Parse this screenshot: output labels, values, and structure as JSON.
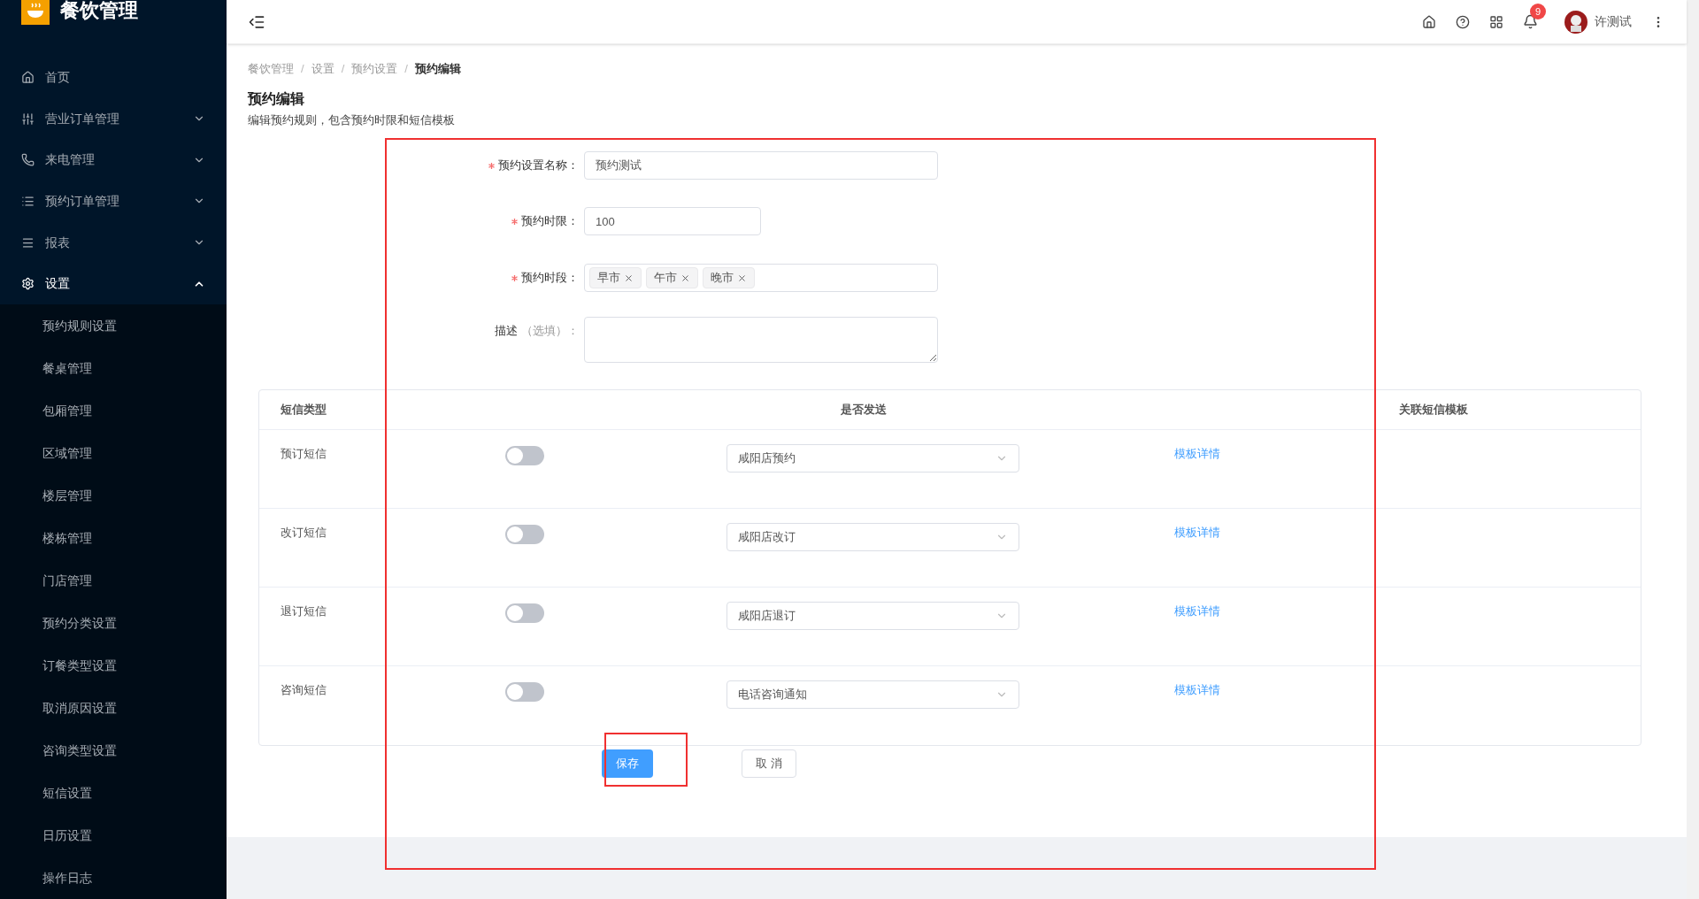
{
  "app": {
    "title": "餐饮管理"
  },
  "sidebar": {
    "items": [
      {
        "label": "首页",
        "selected": false
      },
      {
        "label": "营业订单管理",
        "expanded": false,
        "selected": false
      },
      {
        "label": "来电管理",
        "expanded": false,
        "selected": false
      },
      {
        "label": "预约订单管理",
        "expanded": false,
        "selected": false
      },
      {
        "label": "报表",
        "expanded": false,
        "selected": false
      },
      {
        "label": "设置",
        "expanded": true,
        "selected": true,
        "children": [
          {
            "label": "预约规则设置"
          },
          {
            "label": "餐桌管理"
          },
          {
            "label": "包厢管理"
          },
          {
            "label": "区域管理"
          },
          {
            "label": "楼层管理"
          },
          {
            "label": "楼栋管理"
          },
          {
            "label": "门店管理"
          },
          {
            "label": "预约分类设置"
          },
          {
            "label": "订餐类型设置"
          },
          {
            "label": "取消原因设置"
          },
          {
            "label": "咨询类型设置"
          },
          {
            "label": "短信设置"
          },
          {
            "label": "日历设置"
          },
          {
            "label": "操作日志"
          }
        ]
      }
    ]
  },
  "header": {
    "notification_count": "9",
    "user_name": "许测试"
  },
  "breadcrumb": [
    {
      "label": "餐饮管理",
      "current": false
    },
    {
      "separator": "/",
      "label": "设置",
      "current": false
    },
    {
      "separator": "/",
      "label": "预约设置",
      "current": false
    },
    {
      "separator": "/",
      "label": "预约编辑",
      "current": true
    }
  ],
  "page": {
    "title": "预约编辑",
    "subtitle": "编辑预约规则，包含预约时限和短信模板"
  },
  "form": {
    "fields": [
      {
        "kind": "text",
        "label": "预约设置名称：",
        "required": true,
        "value": "预约测试"
      },
      {
        "kind": "short",
        "label": "预约时限：",
        "required": true,
        "value": "100"
      },
      {
        "kind": "tags",
        "label": "预约时段：",
        "required": true,
        "tags": [
          "早市",
          "午市",
          "晚市"
        ]
      },
      {
        "kind": "textarea",
        "label": "描述",
        "hint": "（选填）：",
        "required": false
      }
    ]
  },
  "sms_table": {
    "columns": [
      "短信类型",
      "是否发送",
      "关联短信模板"
    ],
    "rows": [
      {
        "type": "预订短信",
        "on": false,
        "template": "咸阳店预约",
        "link": "模板详情"
      },
      {
        "type": "改订短信",
        "on": false,
        "template": "咸阳店改订",
        "link": "模板详情"
      },
      {
        "type": "退订短信",
        "on": false,
        "template": "咸阳店退订",
        "link": "模板详情"
      },
      {
        "type": "咨询短信",
        "on": false,
        "template": "电话咨询通知",
        "link": "模板详情"
      }
    ]
  },
  "buttons": [
    {
      "label": "保存",
      "kind": "primary"
    },
    {
      "label": "取 消",
      "kind": "default"
    }
  ]
}
